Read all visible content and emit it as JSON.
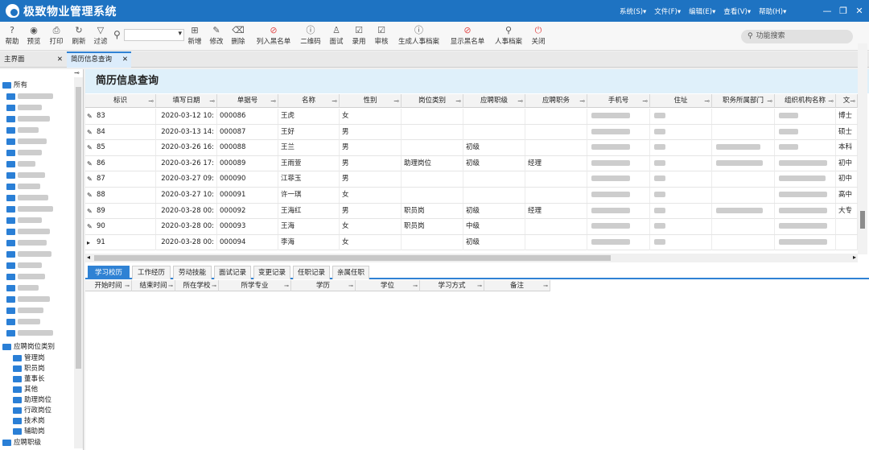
{
  "app": {
    "title": "极致物业管理系统"
  },
  "menus": [
    {
      "label": "系统(S)▾"
    },
    {
      "label": "文件(F)▾"
    },
    {
      "label": "编辑(E)▾"
    },
    {
      "label": "查看(V)▾"
    },
    {
      "label": "帮助(H)▾"
    }
  ],
  "toolbar": {
    "items": [
      {
        "label": "帮助",
        "icon": "help-icon",
        "glyph": "?"
      },
      {
        "label": "预览",
        "icon": "eye-icon",
        "glyph": "◉"
      },
      {
        "label": "打印",
        "icon": "print-icon",
        "glyph": "⎙"
      },
      {
        "label": "刷新",
        "icon": "refresh-icon",
        "glyph": "↻"
      },
      {
        "label": "过滤",
        "icon": "filter-icon",
        "glyph": "▽"
      },
      {
        "label": "新增",
        "icon": "add-icon",
        "glyph": "⊞"
      },
      {
        "label": "修改",
        "icon": "edit-icon",
        "glyph": "✎"
      },
      {
        "label": "删除",
        "icon": "trash-icon",
        "glyph": "🗑"
      },
      {
        "label": "列入黑名单",
        "icon": "ban-icon",
        "glyph": "⊘"
      },
      {
        "label": "二维码",
        "icon": "qr-icon",
        "glyph": "ⓘ"
      },
      {
        "label": "面试",
        "icon": "person-icon",
        "glyph": "♙"
      },
      {
        "label": "录用",
        "icon": "check-doc-icon",
        "glyph": "☑"
      },
      {
        "label": "审核",
        "icon": "review-icon",
        "glyph": "☑"
      },
      {
        "label": "生成人事档案",
        "icon": "info-icon",
        "glyph": "ⓘ"
      },
      {
        "label": "显示黑名单",
        "icon": "ban-icon",
        "glyph": "⊘"
      },
      {
        "label": "人事档案",
        "icon": "search-icon",
        "glyph": "⚲"
      },
      {
        "label": "关闭",
        "icon": "power-icon",
        "glyph": "⏻"
      }
    ],
    "func_search_placeholder": "功能搜索"
  },
  "tabs": [
    {
      "label": "主界面"
    },
    {
      "label": "简历信息查询"
    }
  ],
  "tree": {
    "root": "所有",
    "category": "应聘岗位类别",
    "category_items": [
      "管理岗",
      "职员岗",
      "董事长",
      "其他",
      "助理岗位",
      "行政岗位",
      "技术岗",
      "辅助岗"
    ],
    "next": "应聘职级"
  },
  "main": {
    "title": "简历信息查询",
    "columns": [
      "标识",
      "填写日期",
      "单据号",
      "名称",
      "性别",
      "岗位类别",
      "应聘职级",
      "应聘职务",
      "手机号",
      "住址",
      "职务所属部门",
      "组织机构名称",
      "文"
    ],
    "rows": [
      {
        "id": "83",
        "date": "2020-03-12 10:",
        "no": "000086",
        "name": "王虎",
        "sex": "女",
        "type": "",
        "level": "",
        "post": "",
        "edu": "博士"
      },
      {
        "id": "84",
        "date": "2020-03-13 14:",
        "no": "000087",
        "name": "王好",
        "sex": "男",
        "type": "",
        "level": "",
        "post": "",
        "edu": "硕士"
      },
      {
        "id": "85",
        "date": "2020-03-26 16:",
        "no": "000088",
        "name": "王兰",
        "sex": "男",
        "type": "",
        "level": "初级",
        "post": "",
        "edu": "本科"
      },
      {
        "id": "86",
        "date": "2020-03-26 17:",
        "no": "000089",
        "name": "王雨萱",
        "sex": "男",
        "type": "助理岗位",
        "level": "初级",
        "post": "经理",
        "edu": "初中"
      },
      {
        "id": "87",
        "date": "2020-03-27 09:",
        "no": "000090",
        "name": "江菲玉",
        "sex": "男",
        "type": "",
        "level": "",
        "post": "",
        "edu": "初中"
      },
      {
        "id": "88",
        "date": "2020-03-27 10:",
        "no": "000091",
        "name": "许一琪",
        "sex": "女",
        "type": "",
        "level": "",
        "post": "",
        "edu": "高中"
      },
      {
        "id": "89",
        "date": "2020-03-28 00:",
        "no": "000092",
        "name": "王海红",
        "sex": "男",
        "type": "职员岗",
        "level": "初级",
        "post": "经理",
        "edu": "大专"
      },
      {
        "id": "90",
        "date": "2020-03-28 00:",
        "no": "000093",
        "name": "王海",
        "sex": "女",
        "type": "职员岗",
        "level": "中级",
        "post": "",
        "edu": ""
      },
      {
        "id": "91",
        "date": "2020-03-28 00:",
        "no": "000094",
        "name": "李海",
        "sex": "女",
        "type": "",
        "level": "初级",
        "post": "",
        "edu": ""
      }
    ]
  },
  "subtabs": [
    "学习校历",
    "工作经历",
    "劳动技能",
    "面试记录",
    "变更记录",
    "任职记录",
    "亲属任职"
  ],
  "subcolumns": [
    "开始时间",
    "结束时间",
    "所在学校",
    "所学专业",
    "学历",
    "学位",
    "学习方式",
    "备注"
  ]
}
